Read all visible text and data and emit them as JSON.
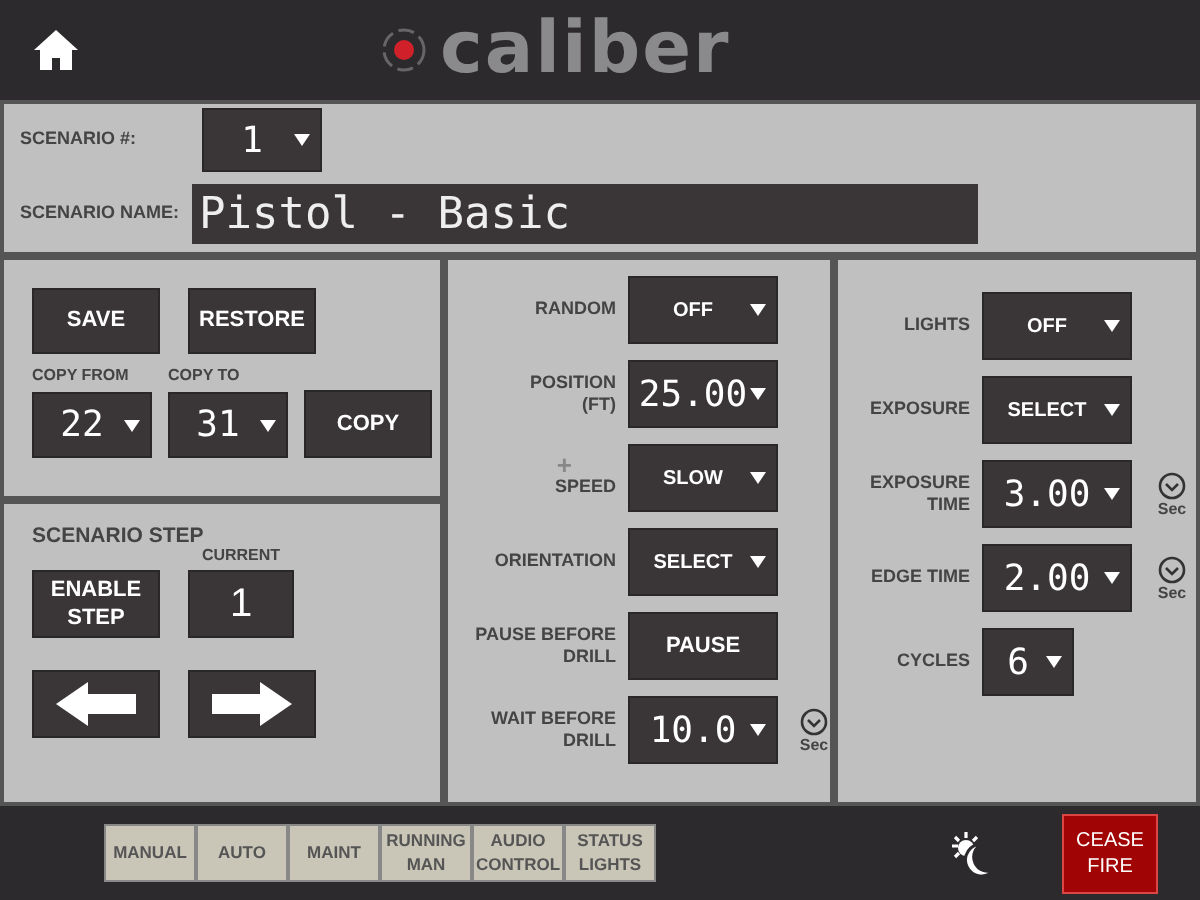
{
  "header": {
    "logo": "caliber"
  },
  "scenario": {
    "number_label": "SCENARIO #:",
    "number": "1",
    "name_label": "SCENARIO NAME:",
    "name": "Pistol - Basic"
  },
  "file_actions": {
    "buttons": [
      "SAVE",
      "RESTORE"
    ],
    "copy_from_label": "COPY FROM",
    "copy_from": "22",
    "copy_to_label": "COPY TO",
    "copy_to": "31",
    "copy_button": "COPY"
  },
  "scenario_step": {
    "title": "SCENARIO STEP",
    "enable_button": "ENABLE\nSTEP",
    "current_label": "CURRENT",
    "current": "1"
  },
  "target_settings": [
    {
      "label": "RANDOM",
      "kind": "text-select",
      "value": "OFF"
    },
    {
      "label": "POSITION\n(FT)",
      "kind": "number-select",
      "value": "25.00"
    },
    {
      "label": "SPEED",
      "marker": "+",
      "kind": "text-select",
      "value": "SLOW"
    },
    {
      "label": "ORIENTATION",
      "kind": "text-select",
      "value": "SELECT"
    },
    {
      "label": "PAUSE BEFORE\nDRILL",
      "kind": "button",
      "value": "PAUSE"
    },
    {
      "label": "WAIT BEFORE\nDRILL",
      "kind": "number-select",
      "value": "10.0",
      "timer_unit": "Sec"
    }
  ],
  "light_settings": [
    {
      "label": "LIGHTS",
      "kind": "text-select",
      "value": "OFF"
    },
    {
      "label": "EXPOSURE",
      "kind": "text-select",
      "value": "SELECT"
    },
    {
      "label": "EXPOSURE\nTIME",
      "kind": "number-select",
      "value": "3.00",
      "timer_unit": "Sec"
    },
    {
      "label": "EDGE TIME",
      "kind": "number-select",
      "value": "2.00",
      "timer_unit": "Sec"
    },
    {
      "label": "CYCLES",
      "kind": "small-number-select",
      "value": "6"
    }
  ],
  "nav_tabs": [
    "MANUAL",
    "AUTO",
    "MAINT",
    "RUNNING\nMAN",
    "AUDIO\nCONTROL",
    "STATUS\nLIGHTS"
  ],
  "cease_fire": "CEASE\nFIRE"
}
